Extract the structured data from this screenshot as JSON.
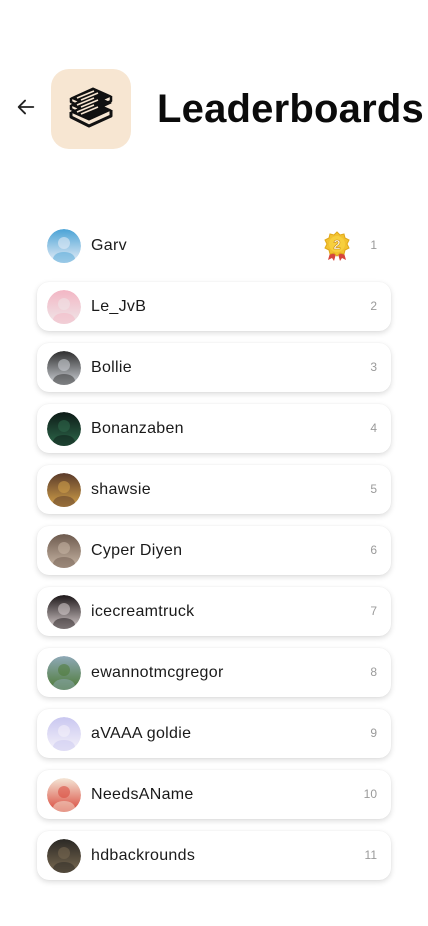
{
  "header": {
    "title": "Leaderboards",
    "back_icon": "arrow-left-icon",
    "app_icon": "stack-books-icon",
    "app_icon_bg": "#f7e6d2"
  },
  "leaderboard": {
    "badge_icon": "medal-badge-icon",
    "badge_label": "2",
    "entries": [
      {
        "name": "Garv",
        "rank": "1",
        "avatar_colors": [
          "#4aa3d6",
          "#e9eef7"
        ]
      },
      {
        "name": "Le_JvB",
        "rank": "2",
        "avatar_colors": [
          "#f3b6c4",
          "#efe6e8"
        ]
      },
      {
        "name": "Bollie",
        "rank": "3",
        "avatar_colors": [
          "#2e2e2e",
          "#cfd3d8"
        ]
      },
      {
        "name": "Bonanzaben",
        "rank": "4",
        "avatar_colors": [
          "#0c1a16",
          "#2f6a4c"
        ]
      },
      {
        "name": "shawsie",
        "rank": "5",
        "avatar_colors": [
          "#5a3a2a",
          "#d3a24a"
        ]
      },
      {
        "name": "Cyper Diyen",
        "rank": "6",
        "avatar_colors": [
          "#6d5a4e",
          "#c9b7a6"
        ]
      },
      {
        "name": "icecreamtruck",
        "rank": "7",
        "avatar_colors": [
          "#1c1618",
          "#d9cfcf"
        ]
      },
      {
        "name": "ewannotmcgregor",
        "rank": "8",
        "avatar_colors": [
          "#8fa9b8",
          "#4d7a34"
        ]
      },
      {
        "name": "aVAAA goldie",
        "rank": "9",
        "avatar_colors": [
          "#c9c7f0",
          "#f5f2fa"
        ]
      },
      {
        "name": "NeedsAName",
        "rank": "10",
        "avatar_colors": [
          "#f4e6d6",
          "#d9473a"
        ]
      },
      {
        "name": "hdbackrounds",
        "rank": "11",
        "avatar_colors": [
          "#2a2824",
          "#7a6a52"
        ]
      }
    ]
  }
}
